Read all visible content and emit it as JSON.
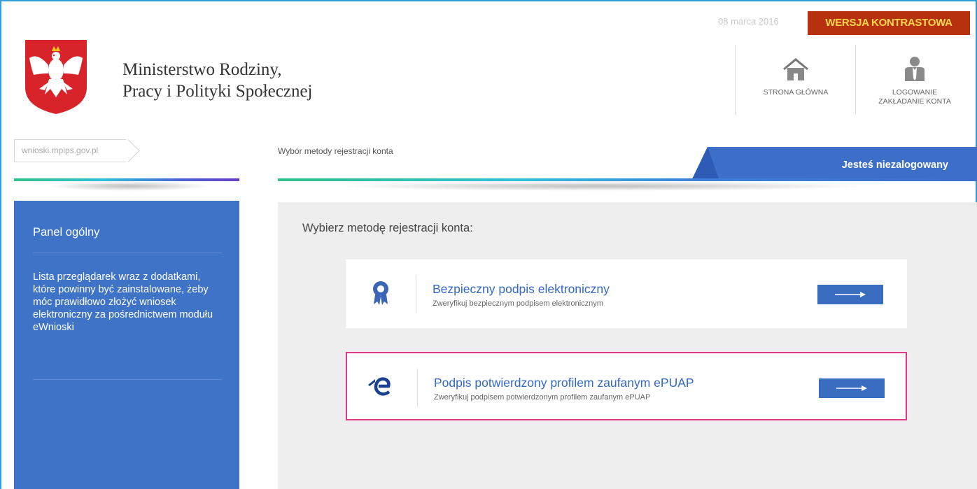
{
  "header": {
    "ministry_line1": "Ministerstwo Rodziny,",
    "ministry_line2": "Pracy i Polityki Społecznej",
    "date": "08 marca 2016",
    "contrast_button": "WERSJA KONTRASTOWA",
    "nav": [
      {
        "icon": "home-icon",
        "label_lines": [
          "STRONA GŁÓWNA"
        ]
      },
      {
        "icon": "user-icon",
        "label_lines": [
          "LOGOWANIE",
          "ZAKŁADANIE KONTA"
        ]
      }
    ]
  },
  "breadcrumb": {
    "domain": "wnioski.mpips.gov.pl",
    "current": "Wybór metody rejestracji konta",
    "login_status": "Jesteś niezalogowany"
  },
  "sidebar": {
    "title": "Panel ogólny",
    "description": "Lista przeglądarek wraz z dodatkami, które powinny być zainstalowane, żeby móc prawidłowo złożyć wniosek elektroniczny za pośrednictwem modułu eWnioski"
  },
  "main": {
    "heading": "Wybierz metodę rejestracji konta:",
    "methods": [
      {
        "icon": "certificate-icon",
        "title": "Bezpieczny podpis elektroniczny",
        "subtitle": "Zweryfikuj bezpiecznym podpisem elektronicznym",
        "highlighted": false
      },
      {
        "icon": "epuap-icon",
        "title": "Podpis potwierdzony profilem zaufanym ePUAP",
        "subtitle": "Zweryfikuj podpisem potwierdzonym profilem zaufanym ePUAP",
        "highlighted": true
      }
    ]
  },
  "colors": {
    "frame": "#2f9fd8",
    "contrast_bg": "#b8310e",
    "contrast_text": "#ffd84a",
    "sidebar_bg": "#3f73c8",
    "accent_blue": "#3368c7",
    "highlight_border": "#e4398b",
    "main_bg": "#eeeeee"
  }
}
